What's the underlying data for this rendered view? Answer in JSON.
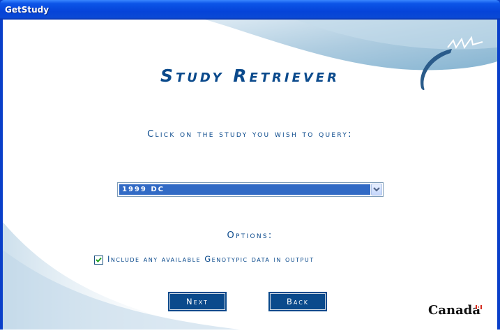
{
  "window": {
    "title": "GetStudy"
  },
  "header": {
    "title": "Study Retriever"
  },
  "prompt": {
    "text": "Click on the study you wish to query:"
  },
  "study_select": {
    "selected": "1999 DC"
  },
  "options": {
    "label": "Options:",
    "include_genotypic": {
      "label": "Include any available Genotypic data in output",
      "checked": true
    }
  },
  "buttons": {
    "next": "Next",
    "back": "Back"
  },
  "branding": {
    "wordmark": "Canada"
  },
  "colors": {
    "accent": "#0b4a8c",
    "selection": "#316ac5",
    "titlebar": "#0543d8"
  },
  "icons": {
    "logo": "swoosh-logo-icon",
    "dropdown": "chevron-down-icon",
    "check": "checkmark-icon",
    "flag": "canada-flag-icon"
  }
}
